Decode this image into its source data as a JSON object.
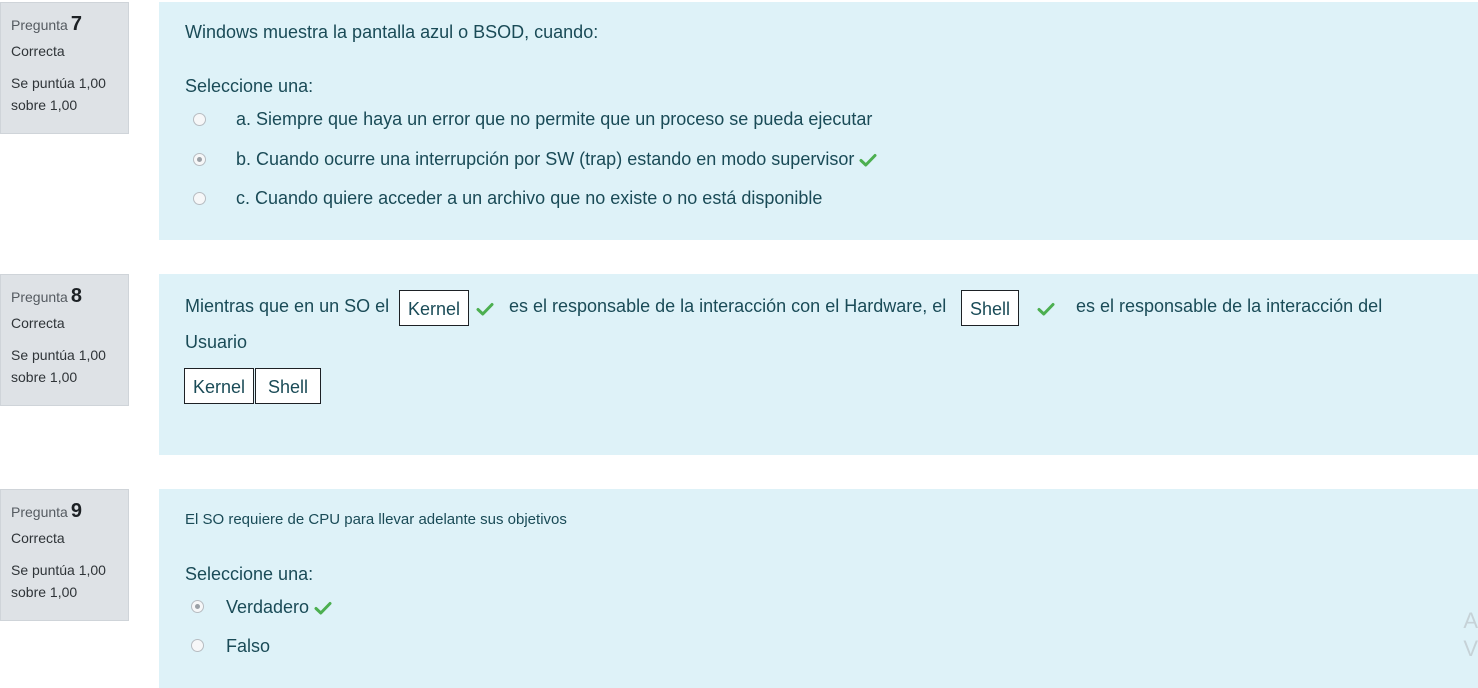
{
  "questions": [
    {
      "label": "Pregunta",
      "number": "7",
      "state": "Correcta",
      "grade": "Se puntúa 1,00 sobre 1,00",
      "text": "Windows muestra la pantalla azul o BSOD, cuando:",
      "prompt": "Seleccione una:",
      "options": [
        {
          "text": "a. Siempre que haya un error que no permite que un proceso se pueda ejecutar",
          "selected": false,
          "correct": false
        },
        {
          "text": "b. Cuando ocurre una interrupción por SW (trap) estando en modo supervisor",
          "selected": true,
          "correct": true
        },
        {
          "text": "c. Cuando quiere acceder a un archivo que no existe o no está disponible",
          "selected": false,
          "correct": false
        }
      ]
    },
    {
      "label": "Pregunta",
      "number": "8",
      "state": "Correcta",
      "grade": "Se puntúa 1,00 sobre 1,00",
      "text_part1": "Mientras que en un SO el",
      "drop1": "Kernel",
      "text_part2": "es el responsable de la interacción con el Hardware, el",
      "drop2": "Shell",
      "text_part3": "es el responsable de la interacción del",
      "text_part4": "Usuario",
      "choices": [
        "Kernel",
        "Shell"
      ]
    },
    {
      "label": "Pregunta",
      "number": "9",
      "state": "Correcta",
      "grade": "Se puntúa 1,00 sobre 1,00",
      "text": "El SO requiere de CPU para llevar adelante sus objetivos",
      "prompt": "Seleccione una:",
      "options": [
        {
          "text": "Verdadero",
          "selected": true,
          "correct": true
        },
        {
          "text": "Falso",
          "selected": false,
          "correct": false
        }
      ]
    }
  ],
  "ghost_letters": [
    "A",
    "V"
  ],
  "colors": {
    "correct": "#4caf50",
    "panel": "#def2f8",
    "info": "#dee2e6"
  }
}
